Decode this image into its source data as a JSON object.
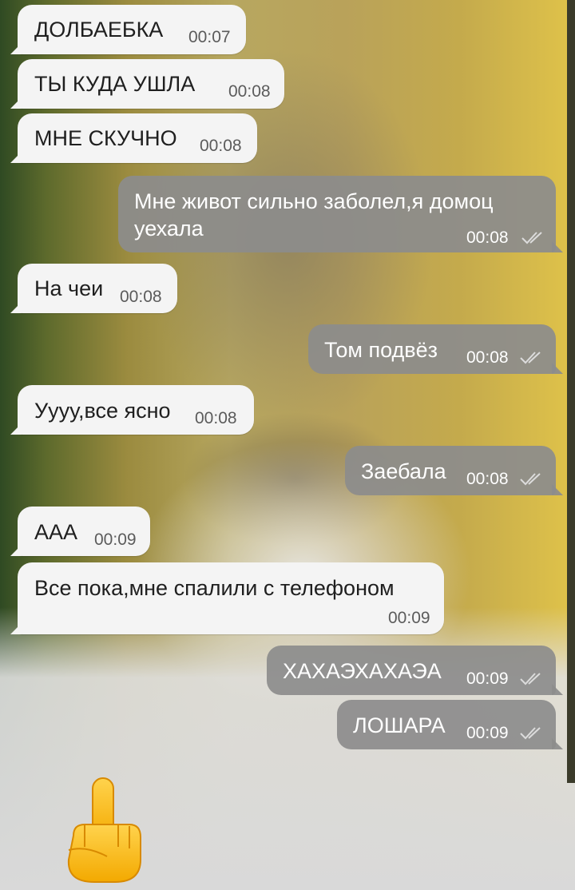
{
  "messages": [
    {
      "dir": "in",
      "text": "ДОЛБАЕБКА",
      "time": "00:07"
    },
    {
      "dir": "in",
      "text": "ТЫ КУДА УШЛА",
      "time": "00:08"
    },
    {
      "dir": "in",
      "text": "МНЕ СКУЧНО",
      "time": "00:08"
    },
    {
      "dir": "out",
      "text_line1": "Мне живот сильно заболел,я домоц",
      "text_line2": "уехала",
      "time": "00:08"
    },
    {
      "dir": "in",
      "text": "На чеи",
      "time": "00:08"
    },
    {
      "dir": "out",
      "text": "Том подвёз",
      "time": "00:08"
    },
    {
      "dir": "in",
      "text": "Уууу,все ясно",
      "time": "00:08"
    },
    {
      "dir": "out",
      "text": "Заебала",
      "time": "00:08"
    },
    {
      "dir": "in",
      "text": "ААА",
      "time": "00:09"
    },
    {
      "dir": "in",
      "text": "Все пока,мне спалили с телефоном",
      "time": "00:09"
    },
    {
      "dir": "out",
      "text": "ХАХАЭХАХАЭА",
      "time": "00:09"
    },
    {
      "dir": "out",
      "text": "ЛОШАРА",
      "time": "00:09"
    }
  ],
  "emoji": {
    "name": "middle-finger-emoji",
    "color": "#f7b500"
  },
  "colors": {
    "incoming_bubble": "#f4f4f4",
    "outgoing_bubble": "#8c8c8c",
    "read_ticks": "#dcdcdc"
  }
}
